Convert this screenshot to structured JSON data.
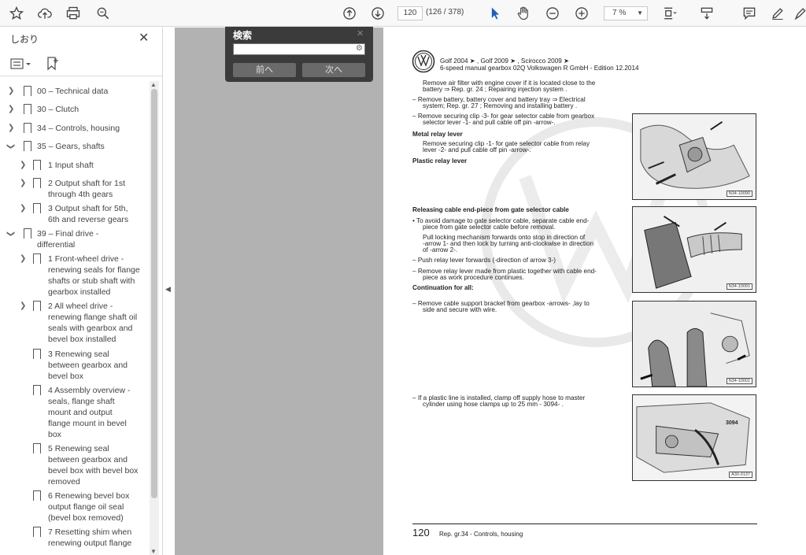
{
  "toolbar": {
    "page_current": "120",
    "page_count": "(126 / 378)",
    "zoom": "7 %"
  },
  "sidebar": {
    "title": "しおり",
    "items": [
      {
        "label": "00 – Technical data"
      },
      {
        "label": "30 – Clutch"
      },
      {
        "label": "34 – Controls, housing"
      },
      {
        "label": "35 – Gears, shafts"
      },
      {
        "label": "1 Input shaft"
      },
      {
        "label": "2 Output shaft for 1st",
        "label2": "through 4th gears"
      },
      {
        "label": "3 Output shaft for 5th,",
        "label2": "6th and reverse gears"
      },
      {
        "label": "39 – Final drive -",
        "label2": "differential"
      },
      {
        "label": "1 Front-wheel drive -",
        "label2": "renewing seals for flange",
        "label3": "shafts or stub shaft with",
        "label4": "gearbox installed"
      },
      {
        "label": "2 All wheel drive -",
        "label2": "renewing flange shaft oil",
        "label3": "seals with gearbox and",
        "label4": "bevel box installed"
      },
      {
        "label": "3 Renewing seal",
        "label2": "between gearbox and",
        "label3": "bevel box"
      },
      {
        "label": "4 Assembly overview -",
        "label2": "seals, flange shaft",
        "label3": "mount and output",
        "label4": "flange mount in bevel",
        "label5": "box"
      },
      {
        "label": "5 Renewing seal",
        "label2": "between gearbox and",
        "label3": "bevel box with bevel box",
        "label4": "removed"
      },
      {
        "label": "6 Renewing bevel box",
        "label2": "output flange oil seal",
        "label3": "(bevel box removed)"
      },
      {
        "label": "7 Resetting shim when",
        "label2": "renewing output flange"
      }
    ]
  },
  "search": {
    "title": "検索",
    "prev": "前へ",
    "next": "次へ"
  },
  "doc": {
    "header1": "Golf 2004 ➤ , Golf 2009 ➤ , Scirocco 2009 ➤",
    "header2": "6-speed manual gearbox 02Q Volkswagen R GmbH - Edition 12.2014",
    "l1": "Remove air filter with engine cover if it is located close to the",
    "l2": "battery ⇒ Rep. gr. 24 ; Repairing injection system .",
    "l3": "– Remove battery, battery cover and battery tray ⇒ Electrical",
    "l4": "system; Rep. gr. 27 ; Removing and installing battery .",
    "l5": "– Remove securing clip -3- for gear selector cable from gearbox",
    "l6": "selector lever -1- and pull cable off pin -arrow-.",
    "h1": "Metal relay lever",
    "l7": "Remove securing clip -1- for gate selector cable from relay",
    "l8": "lever -2- and pull cable off pin -arrow-.",
    "h2": "Plastic relay lever",
    "h3": "Releasing cable end-piece from gate selector cable",
    "l9": "• To avoid damage to gate selector cable, separate cable end-",
    "l10": "piece from gate selector cable before removal.",
    "l11": "Pull locking mechanism forwards onto stop in direction of",
    "l12": "-arrow 1- and then lock by turning anti-clockwise in direction",
    "l13": "of -arrow 2-.",
    "l14": "– Push relay lever forwards (-direction of arrow 3-)",
    "l15": "– Remove relay lever made from plastic together with cable end-",
    "l16": "piece as work procedure continues.",
    "h4": "Continuation for all:",
    "l17": "– Remove cable support bracket from gearbox -arrows- ,lay to",
    "l18": "side and secure with wire.",
    "l19": "– If a plastic line is installed, clamp off supply hose to master",
    "l20": "cylinder using hose clamps up to 25 mm - 3094- .",
    "fig1_code": "N34-10090",
    "fig2_code": "N34-10091",
    "fig3_code": "N34-10001",
    "fig4_code": "A30-0137",
    "fig4_label": "3094",
    "page_number": "120",
    "foot": "Rep. gr.34 - Controls, housing"
  }
}
